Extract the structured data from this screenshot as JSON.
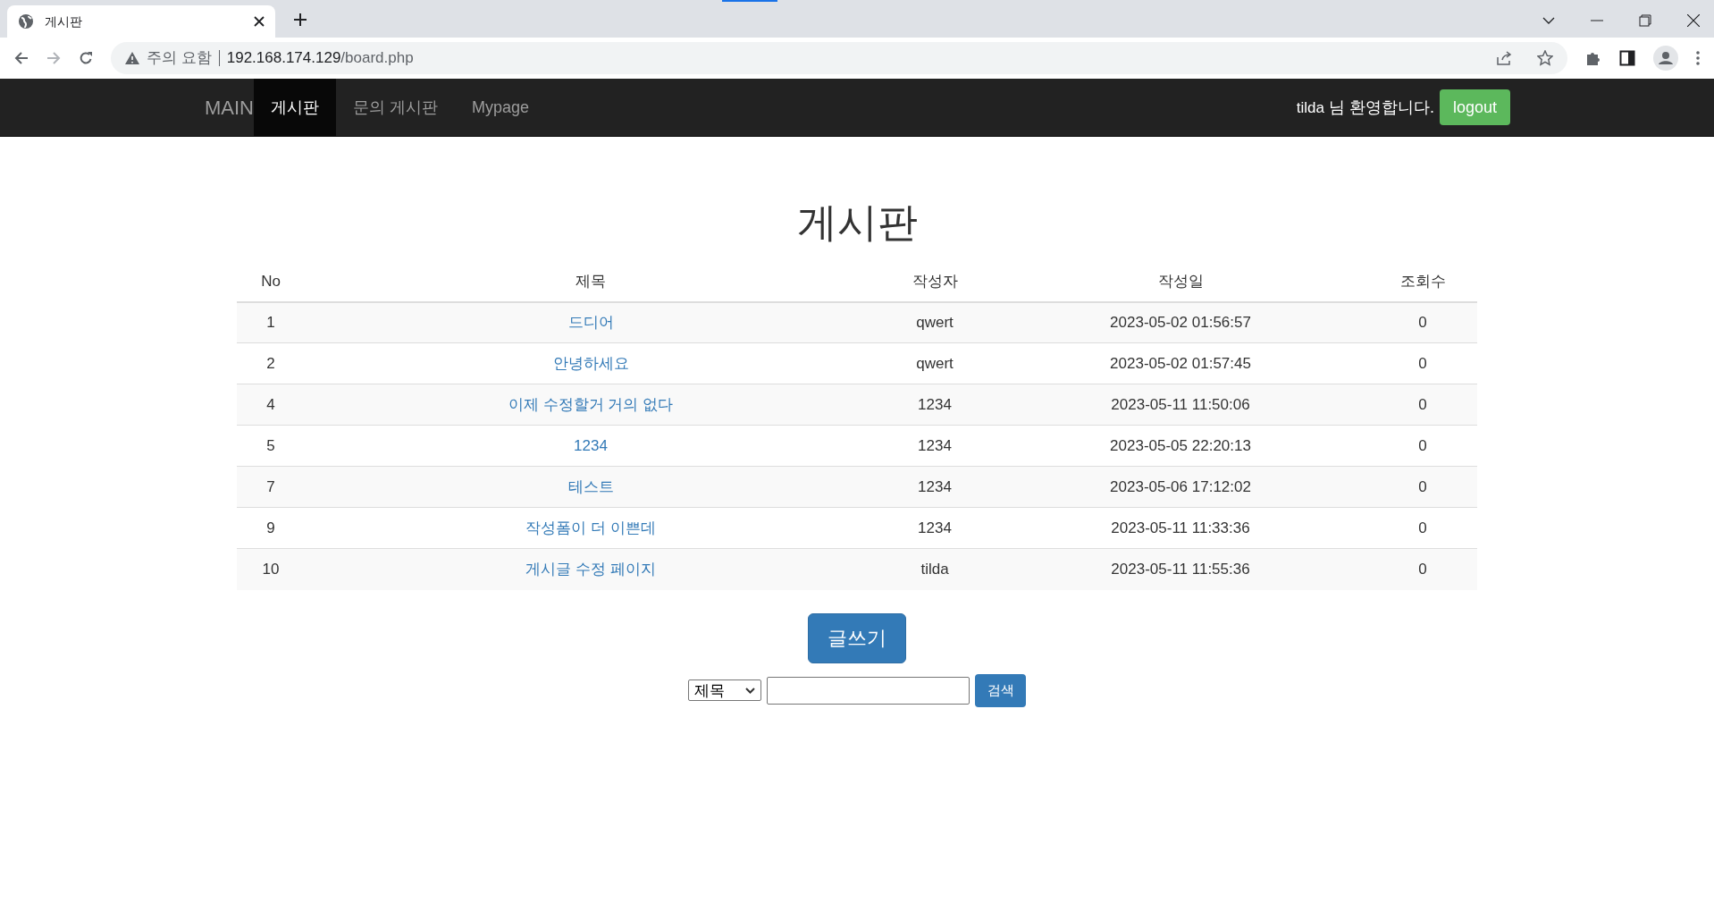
{
  "browser": {
    "tab_title": "게시판",
    "security_label": "주의 요함",
    "url_host": "192.168.174.129",
    "url_path": "/board.php"
  },
  "navbar": {
    "brand": "MAIN",
    "items": [
      {
        "label": "게시판",
        "selected": true
      },
      {
        "label": "문의 게시판",
        "selected": false
      },
      {
        "label": "Mypage",
        "selected": false
      }
    ],
    "user": "tilda",
    "welcome": "님 환영합니다.",
    "logout": "logout"
  },
  "heading": "게시판",
  "table": {
    "columns": [
      "No",
      "제목",
      "작성자",
      "작성일",
      "조회수"
    ],
    "rows": [
      [
        "1",
        "드디어",
        "qwert",
        "2023-05-02 01:56:57",
        "0"
      ],
      [
        "2",
        "안녕하세요",
        "qwert",
        "2023-05-02 01:57:45",
        "0"
      ],
      [
        "4",
        "이제 수정할거 거의 없다",
        "1234",
        "2023-05-11 11:50:06",
        "0"
      ],
      [
        "5",
        "1234",
        "1234",
        "2023-05-05 22:20:13",
        "0"
      ],
      [
        "7",
        "테스트",
        "1234",
        "2023-05-06 17:12:02",
        "0"
      ],
      [
        "9",
        "작성폼이 더 이쁜데",
        "1234",
        "2023-05-11 11:33:36",
        "0"
      ],
      [
        "10",
        "게시글 수정 페이지",
        "tilda",
        "2023-05-11 11:55:36",
        "0"
      ]
    ]
  },
  "write_button": "글쓰기",
  "search": {
    "field": "제목",
    "button": "검색"
  }
}
